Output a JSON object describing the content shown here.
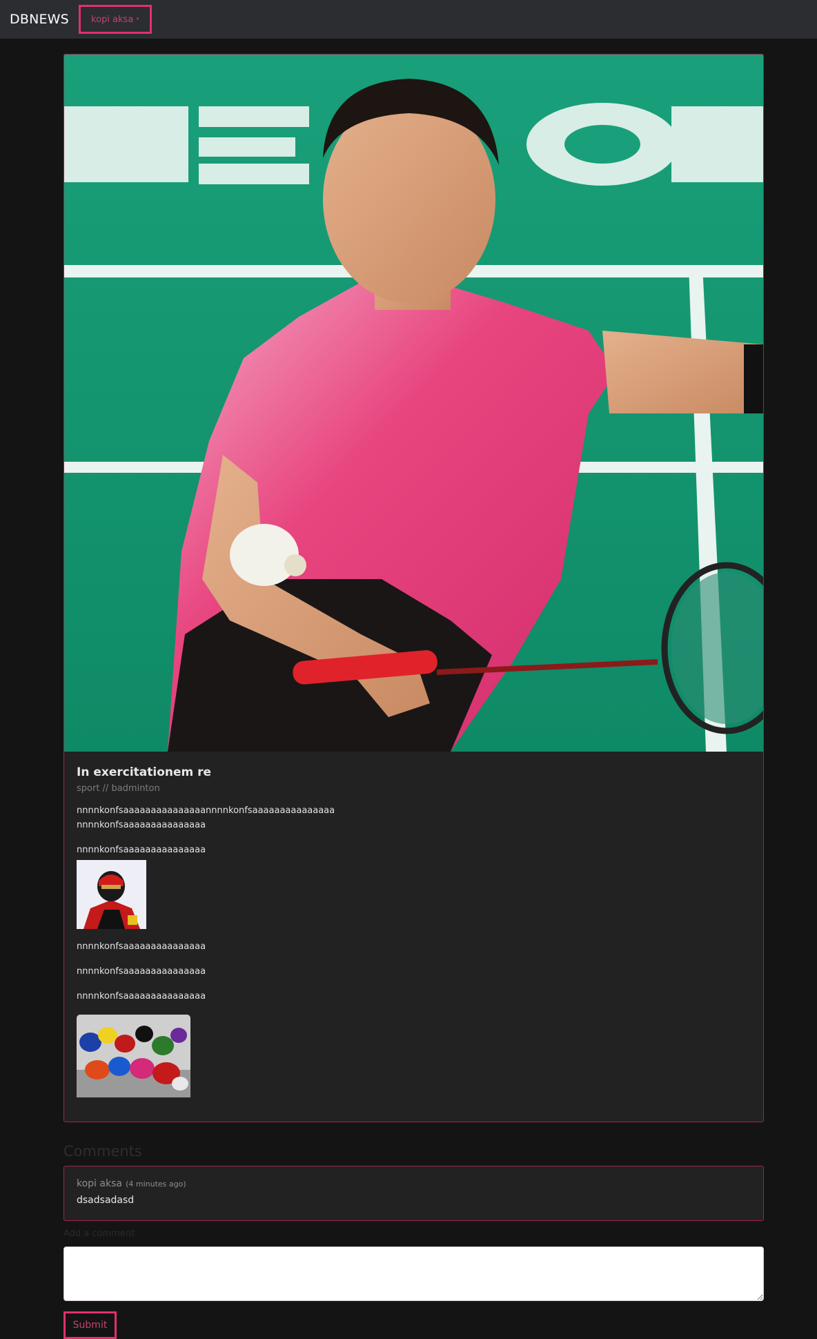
{
  "navbar": {
    "brand": "DBNEWS",
    "user_menu_label": "kopi aksa",
    "caret_icon": "chevron-down-icon"
  },
  "article": {
    "hero_image_icon": "badminton-player-photo",
    "title": "In exercitationem re",
    "category": "sport // badminton",
    "paragraphs": [
      "nnnnkonfsaaaaaaaaaaaaaaannnnkonfsaaaaaaaaaaaaaaa",
      "nnnnkonfsaaaaaaaaaaaaaaa",
      "nnnnkonfsaaaaaaaaaaaaaaa",
      "nnnnkonfsaaaaaaaaaaaaaaa",
      "nnnnkonfsaaaaaaaaaaaaaaa",
      "nnnnkonfsaaaaaaaaaaaaaaa"
    ],
    "inline_images": [
      "racing-driver-photo",
      "motogp-riders-photo"
    ],
    "colors": {
      "accent": "#e3306c",
      "card_border": "#a3244d",
      "card_bg": "#222222"
    }
  },
  "comments": {
    "heading": "Comments",
    "items": [
      {
        "author": "kopi aksa",
        "time": "(4 minutes ago)",
        "text": "dsadsadasd"
      }
    ],
    "add_label": "Add a comment",
    "input_value": "",
    "submit_label": "Submit"
  }
}
